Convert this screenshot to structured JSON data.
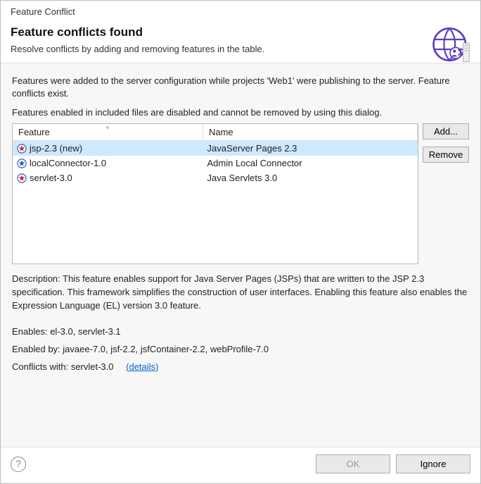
{
  "header": {
    "window_title": "Feature Conflict",
    "heading": "Feature conflicts found",
    "subtitle": "Resolve conflicts by adding and removing features in the table."
  },
  "body": {
    "msg1": "Features were added to the server configuration while projects 'Web1' were publishing to the server. Feature conflicts exist.",
    "msg2": "Features enabled in included files are disabled and cannot be removed by using this dialog.",
    "columns": {
      "feature": "Feature",
      "name": "Name"
    },
    "rows": [
      {
        "feature": "jsp-2.3 (new)",
        "name": "JavaServer Pages 2.3",
        "icon": "star-red",
        "selected": true
      },
      {
        "feature": "localConnector-1.0",
        "name": "Admin Local Connector",
        "icon": "star-blue",
        "selected": false
      },
      {
        "feature": "servlet-3.0",
        "name": "Java Servlets 3.0",
        "icon": "star-red",
        "selected": false
      }
    ],
    "buttons": {
      "add": "Add...",
      "remove": "Remove"
    },
    "desc_label": "Description: ",
    "desc_text": "This feature enables support for Java Server Pages (JSPs) that are written to the JSP 2.3 specification. This framework simplifies the construction of user interfaces. Enabling this feature also enables the Expression Language (EL) version 3.0 feature.",
    "enables_label": "Enables: ",
    "enables_text": "el-3.0, servlet-3.1",
    "enabledby_label": "Enabled by: ",
    "enabledby_text": "javaee-7.0, jsf-2.2, jsfContainer-2.2, webProfile-7.0",
    "conflicts_label": "Conflicts with: ",
    "conflicts_text": "servlet-3.0",
    "details_link": "(details)"
  },
  "footer": {
    "ok": "OK",
    "ignore": "Ignore"
  }
}
